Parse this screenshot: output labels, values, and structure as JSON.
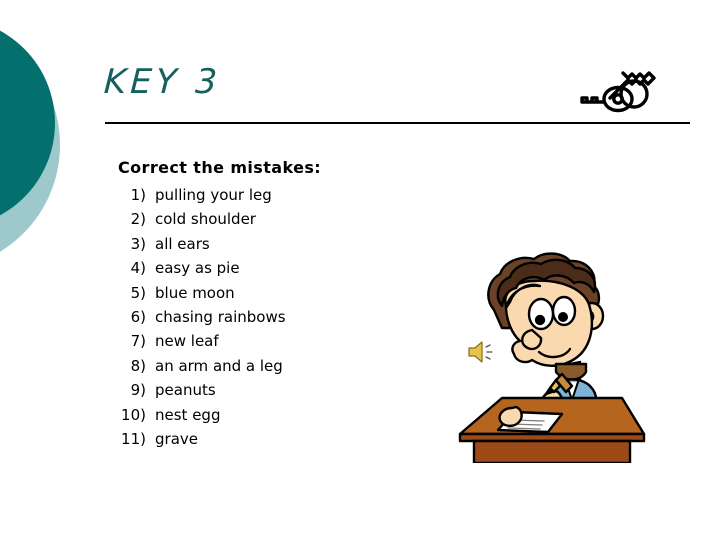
{
  "slide": {
    "title": "KEY 3",
    "title_color": "#16605F",
    "background_color": "#ffffff",
    "rule_color": "#000000"
  },
  "decor": {
    "circle_dark_color": "#04706E",
    "circle_light_color": "#9DC9CC",
    "keys_icon_name": "keys-icon",
    "sound_icon_name": "speaker-icon",
    "illustration_name": "boy-writing-at-desk"
  },
  "body": {
    "heading": "Correct the mistakes:",
    "items": [
      {
        "number": "1)",
        "text": "pulling your leg"
      },
      {
        "number": "2)",
        "text": "cold shoulder"
      },
      {
        "number": "3)",
        "text": "all ears"
      },
      {
        "number": "4)",
        "text": "easy as pie"
      },
      {
        "number": "5)",
        "text": "blue moon"
      },
      {
        "number": "6)",
        "text": "chasing rainbows"
      },
      {
        "number": "7)",
        "text": "new leaf"
      },
      {
        "number": "8)",
        "text": "an arm and a leg"
      },
      {
        "number": "9)",
        "text": "peanuts"
      },
      {
        "number": "10)",
        "text": "nest egg"
      },
      {
        "number": "11)",
        "text": "grave"
      }
    ]
  },
  "illustration_colors": {
    "hair": "#6B4226",
    "hair_dark": "#4A2C18",
    "skin": "#FBD9AE",
    "skin_line": "#000000",
    "shirt": "#7FB4D9",
    "desk_top": "#B5651D",
    "desk_front": "#9C4A18",
    "paper": "#FFFFFF",
    "pencil": "#C98A3A",
    "speaker": "#E8C24A"
  }
}
